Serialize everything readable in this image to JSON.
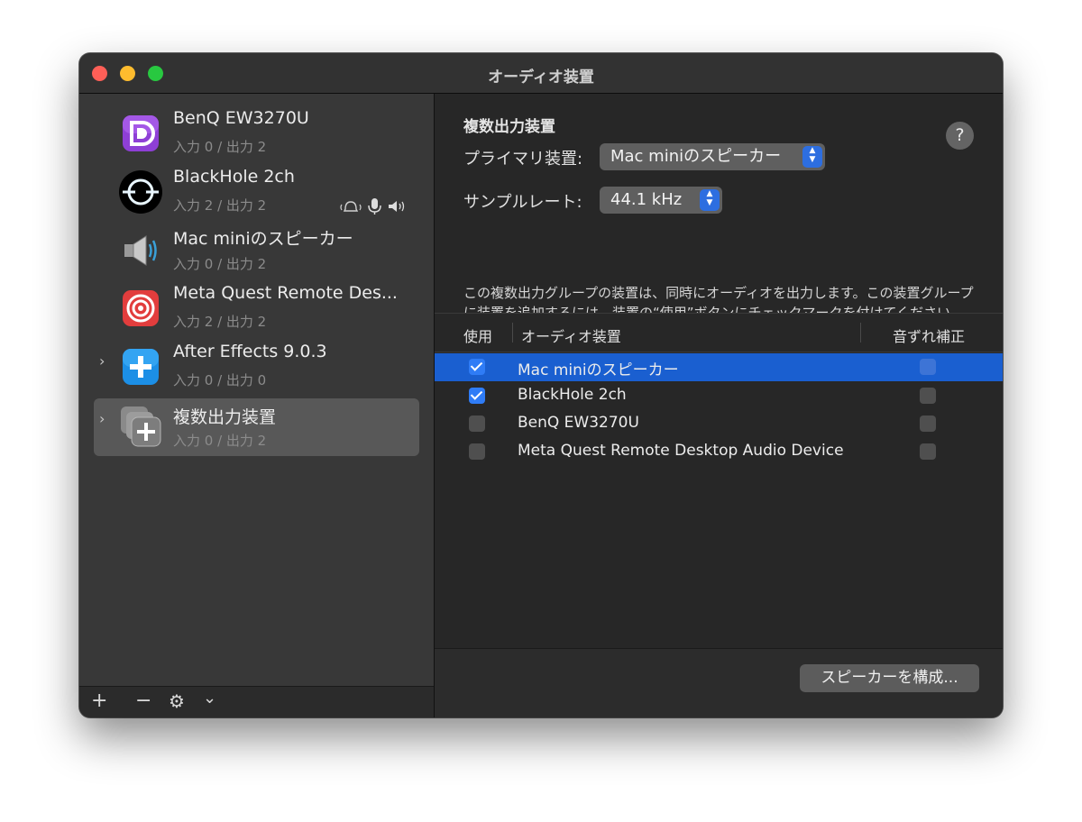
{
  "window": {
    "title": "オーディオ装置"
  },
  "sidebar": {
    "devices": [
      {
        "name": "BenQ EW3270U",
        "io": "入力 0 / 出力 2",
        "icon": "display-port-icon",
        "expandable": false,
        "selected": false
      },
      {
        "name": "BlackHole 2ch",
        "io": "入力 2 / 出力 2",
        "icon": "blackhole-icon",
        "expandable": false,
        "selected": false,
        "status_icons": [
          "alert-sound-icon",
          "microphone-icon",
          "speaker-icon"
        ]
      },
      {
        "name": "Mac miniのスピーカー",
        "io": "入力 0 / 出力 2",
        "icon": "speaker-icon",
        "expandable": false,
        "selected": false
      },
      {
        "name": "Meta Quest Remote Des...",
        "io": "入力 2 / 出力 2",
        "icon": "target-icon",
        "expandable": false,
        "selected": false
      },
      {
        "name": "After Effects 9.0.3",
        "io": "入力 0 / 出力 0",
        "icon": "aggregate-plus-icon",
        "expandable": true,
        "selected": false
      },
      {
        "name": "複数出力装置",
        "io": "入力 0 / 出力 2",
        "icon": "multi-output-icon",
        "expandable": true,
        "selected": true
      }
    ],
    "toolbar": {
      "add": "+",
      "remove": "−",
      "gear": "⚙",
      "menu": "⌄"
    }
  },
  "main": {
    "section_title": "複数出力装置",
    "help": "?",
    "primary_label": "プライマリ装置:",
    "primary_value": "Mac miniのスピーカー",
    "sample_rate_label": "サンプルレート:",
    "sample_rate_value": "44.1 kHz",
    "description": "この複数出力グループの装置は、同時にオーディオを出力します。この装置グループに装置を追加するには、装置の“使用”ボタンにチェックマークを付けてください。",
    "table": {
      "headers": {
        "use": "使用",
        "device": "オーディオ装置",
        "drift": "音ずれ補正"
      },
      "rows": [
        {
          "name": "Mac miniのスピーカー",
          "use": true,
          "drift": false,
          "selected": true
        },
        {
          "name": "BlackHole 2ch",
          "use": true,
          "drift": false,
          "selected": false
        },
        {
          "name": "BenQ EW3270U",
          "use": false,
          "drift": false,
          "selected": false
        },
        {
          "name": "Meta Quest Remote Desktop Audio Device",
          "use": false,
          "drift": false,
          "selected": false
        }
      ]
    },
    "configure_button": "スピーカーを構成..."
  },
  "colors": {
    "accent": "#2f7cf6",
    "selection": "#1a5fd0",
    "close": "#fe5f57",
    "minimize": "#febc2e",
    "zoom": "#28c840"
  }
}
